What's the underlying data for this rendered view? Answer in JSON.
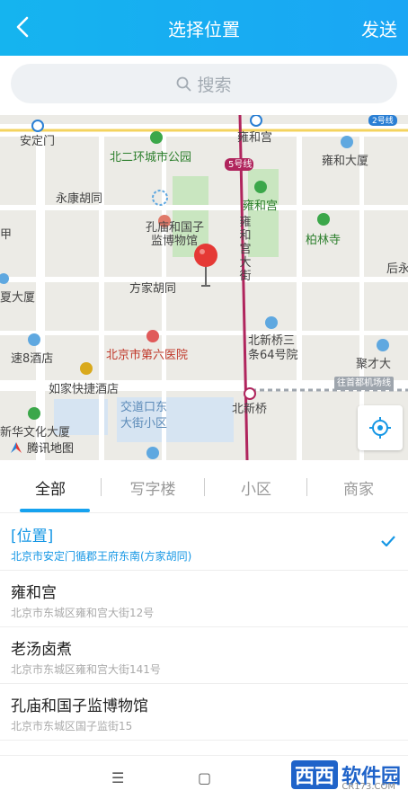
{
  "header": {
    "title": "选择位置",
    "send_label": "发送",
    "background": "#17aff1"
  },
  "search": {
    "placeholder": "搜索"
  },
  "map": {
    "labels": {
      "anding_gate": "安定门",
      "yonghegong_top": "雍和宫",
      "ring_park": "北二环城市公园",
      "metro_line": "5号线",
      "metro_line_2": "2号线",
      "yonghe_building": "雍和大厦",
      "yongkang": "永康胡同",
      "confucius_1": "孔庙和国子",
      "confucius_2": "监博物馆",
      "yonghegong_mid": "雍和宫",
      "yonghe_street": "雍和宫大街",
      "bailin": "柏林寺",
      "jia": "甲",
      "houhou": "后永",
      "fangjia": "方家胡同",
      "xia_building": "夏大厦",
      "beixinqiao_1": "北新桥三",
      "beixinqiao_2": "条64号院",
      "hospital": "北京市第六医院",
      "su8": "速8酒店",
      "jucai": "聚才大",
      "rujia": "如家快捷酒店",
      "airport_line": "往首都机场线",
      "jiaodaokou_1": "交道口东",
      "jiaodaokou_2": "大街小区",
      "beixinqiao": "北新桥",
      "xinhua": "新华文化大厦"
    },
    "brand": "腾讯地图"
  },
  "tabs": [
    {
      "label": "全部",
      "active": true
    },
    {
      "label": "写字楼",
      "active": false
    },
    {
      "label": "小区",
      "active": false
    },
    {
      "label": "商家",
      "active": false
    }
  ],
  "places": [
    {
      "name": "[位置]",
      "address": "北京市安定门循郡王府东南(方家胡同)",
      "selected": true
    },
    {
      "name": "雍和宫",
      "address": "北京市东城区雍和宫大街12号",
      "selected": false
    },
    {
      "name": "老汤卤煮",
      "address": "北京市东城区雍和宫大街141号",
      "selected": false
    },
    {
      "name": "孔庙和国子监博物馆",
      "address": "北京市东城区国子监街15",
      "selected": false
    }
  ],
  "navbar": {
    "menu_glyph": "☰",
    "home_glyph": "▢"
  },
  "watermark": {
    "part1": "西西",
    "part2": "软件园",
    "domain": "CR173.COM"
  },
  "colors": {
    "accent": "#16a2ef",
    "pin": "#e53935",
    "metro": "#b0255d"
  }
}
